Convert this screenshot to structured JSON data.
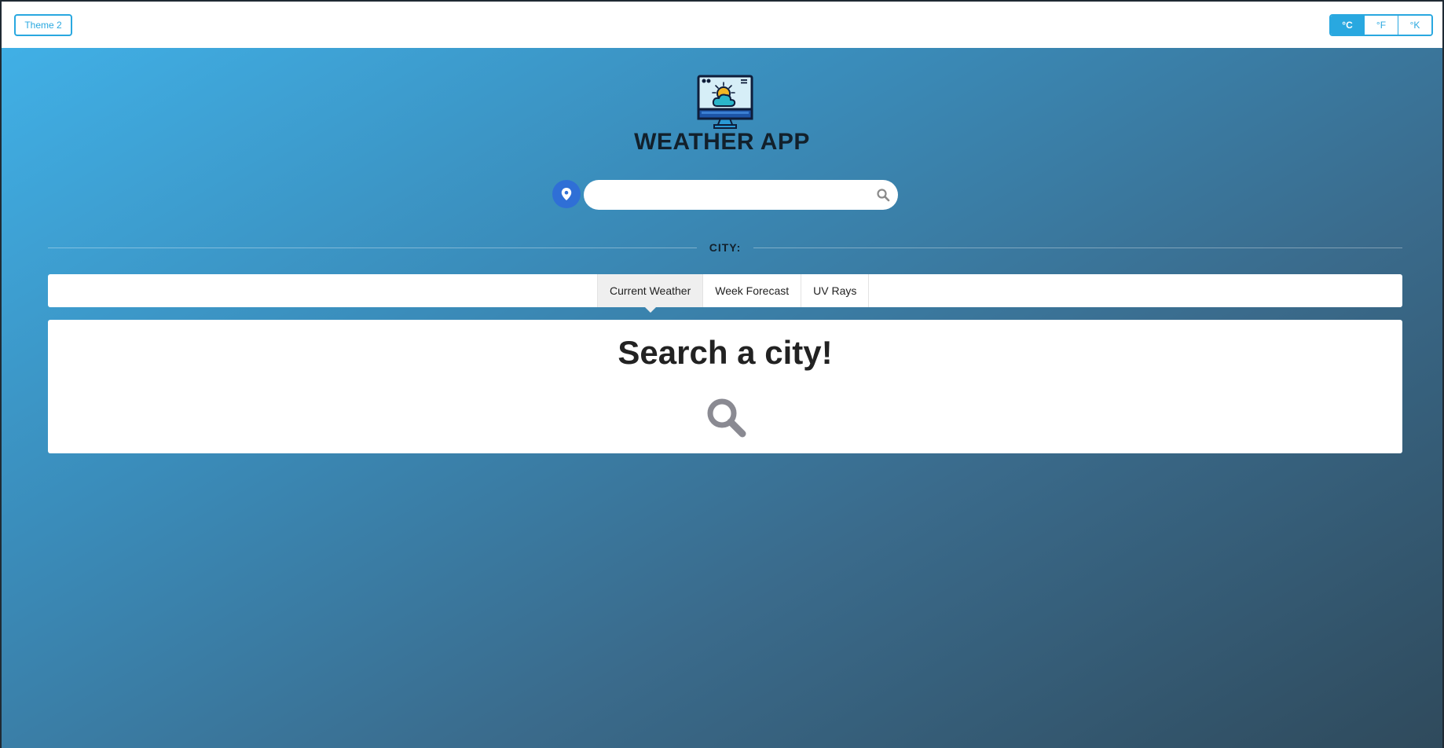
{
  "topbar": {
    "theme_button": "Theme 2",
    "units": [
      "°C",
      "°F",
      "°K"
    ],
    "active_unit": "°C"
  },
  "header": {
    "title": "WEATHER APP",
    "logo_icon": "monitor-weather-icon"
  },
  "search": {
    "placeholder": "",
    "value": "",
    "location_icon": "map-marker-icon",
    "search_icon": "search-icon"
  },
  "city": {
    "label": "CITY:",
    "name": ""
  },
  "tabs": [
    {
      "label": "Current Weather",
      "active": true
    },
    {
      "label": "Week Forecast",
      "active": false
    },
    {
      "label": "UV Rays",
      "active": false
    }
  ],
  "panel": {
    "heading": "Search a city!",
    "icon": "search-icon"
  },
  "colors": {
    "accent": "#29a8e0",
    "location_button": "#2f6fd6",
    "title_text": "#12202b"
  }
}
